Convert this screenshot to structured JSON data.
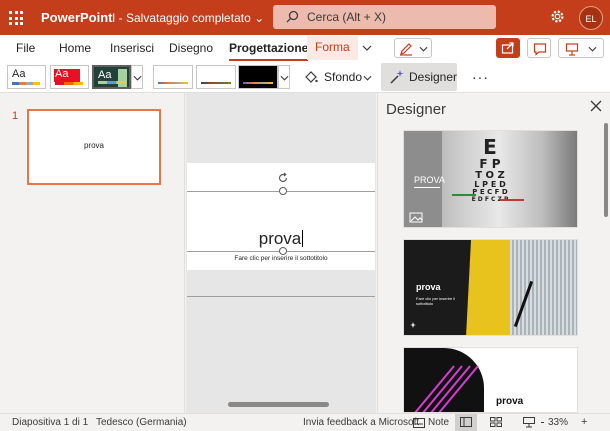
{
  "titlebar": {
    "app_name": "PowerPoint",
    "doc_status": "I - Salvataggio completato ⌄",
    "search_placeholder": "Cerca (Alt + X)",
    "avatar_initials": "EL",
    "accent_color": "#c43e1c"
  },
  "tabs": {
    "items": [
      "File",
      "Home",
      "Inserisci",
      "Disegno",
      "Progettazione",
      "Forma"
    ],
    "active": "Progettazione",
    "contextual": "Forma"
  },
  "ribbon": {
    "theme_label": "Aa",
    "sfondo_label": "Sfondo",
    "designer_label": "Designer",
    "more_label": "···"
  },
  "thumbnails": {
    "slide_number": "1",
    "thumb_text": "prova"
  },
  "slide": {
    "title": "prova",
    "subtitle_placeholder": "Fare clic per inserire il sottotitolo"
  },
  "designer": {
    "title": "Designer",
    "card2_title": "prova",
    "card2_subtitle": "Fare clic per inserire il sottotitolo",
    "card3_title": "prova",
    "card1_title": "PROVA",
    "chart_letters": [
      "E",
      "F P",
      "T O Z",
      "L P E D",
      "P E C F D",
      "E D F C Z P"
    ]
  },
  "statusbar": {
    "slide_info": "Diapositiva 1 di 1",
    "language": "Tedesco (Germania)",
    "feedback": "Invia feedback a Microsoft",
    "notes": "Note",
    "zoom": "33%"
  }
}
